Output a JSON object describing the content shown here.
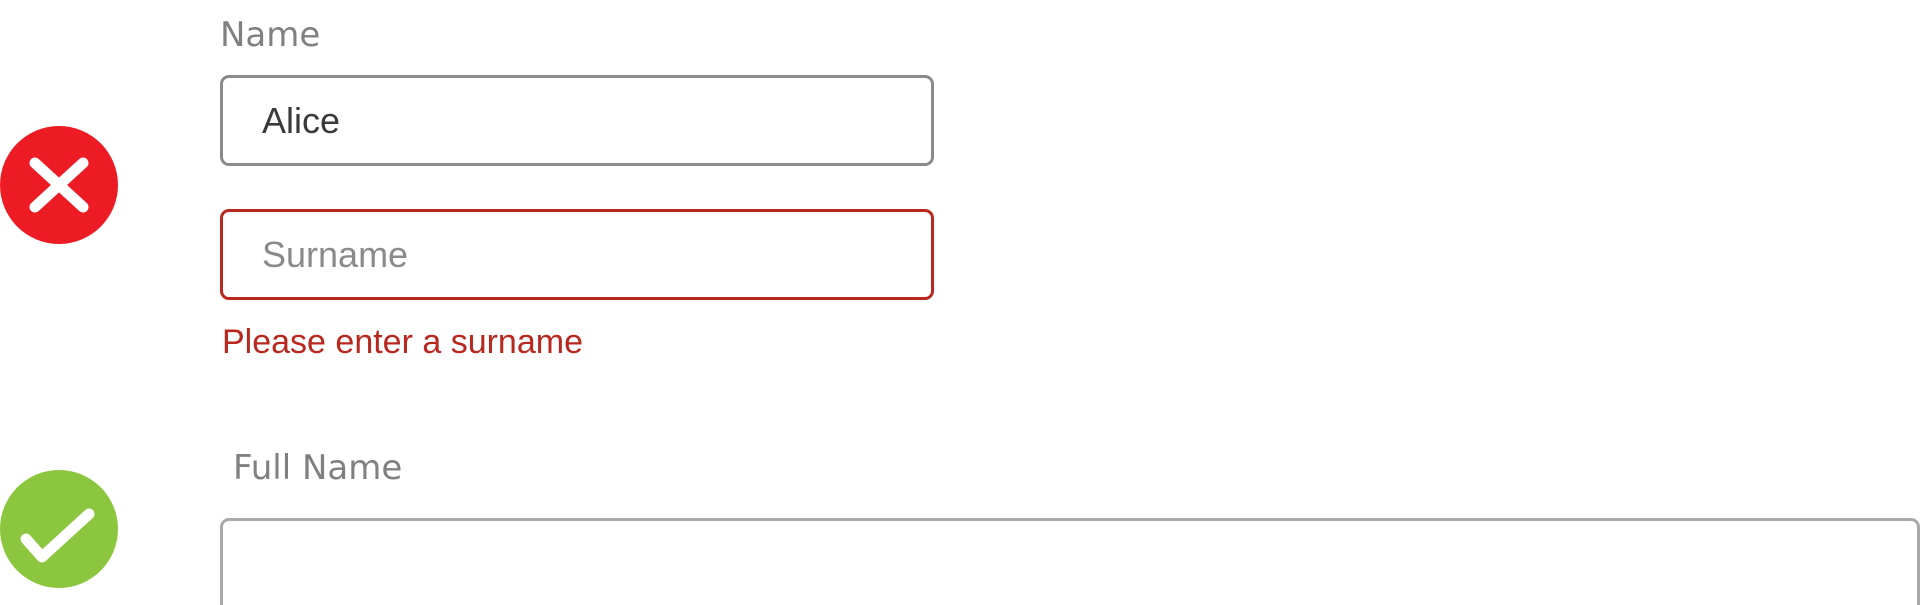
{
  "status_icons": {
    "invalid_example": {
      "icon": "x-icon",
      "color": "#ed1c24"
    },
    "valid_example": {
      "icon": "check-icon",
      "color": "#8cc63f"
    }
  },
  "invalid_form": {
    "name_label": "Name",
    "name_value": "Alice",
    "surname_placeholder": "Surname",
    "surname_error": "Please enter a surname"
  },
  "valid_form": {
    "full_name_label": "Full Name",
    "full_name_value": ""
  },
  "colors": {
    "error": "#b8281f",
    "label": "#808080",
    "border": "#8a8a8a"
  }
}
